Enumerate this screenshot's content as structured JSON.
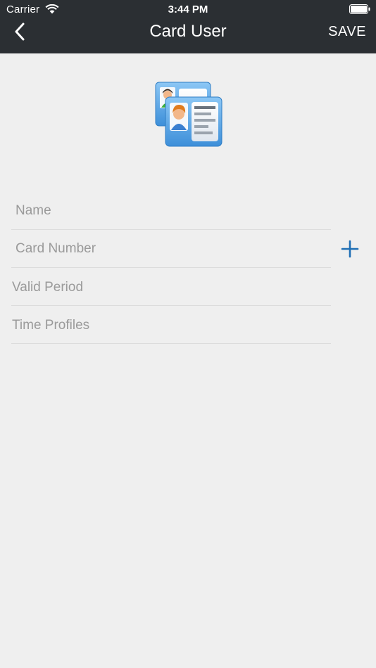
{
  "status_bar": {
    "carrier": "Carrier",
    "time": "3:44 PM"
  },
  "nav": {
    "title": "Card User",
    "save_label": "SAVE",
    "back_icon": "chevron-left-icon"
  },
  "form": {
    "name_placeholder": "Name",
    "card_number_placeholder": "Card Number",
    "valid_period_label": "Valid Period",
    "time_profiles_label": "Time Profiles",
    "add_icon": "plus-icon"
  },
  "colors": {
    "nav_background": "#2b2f33",
    "page_background": "#efefef",
    "accent": "#1f6fb5",
    "placeholder": "#9a9a9a"
  }
}
